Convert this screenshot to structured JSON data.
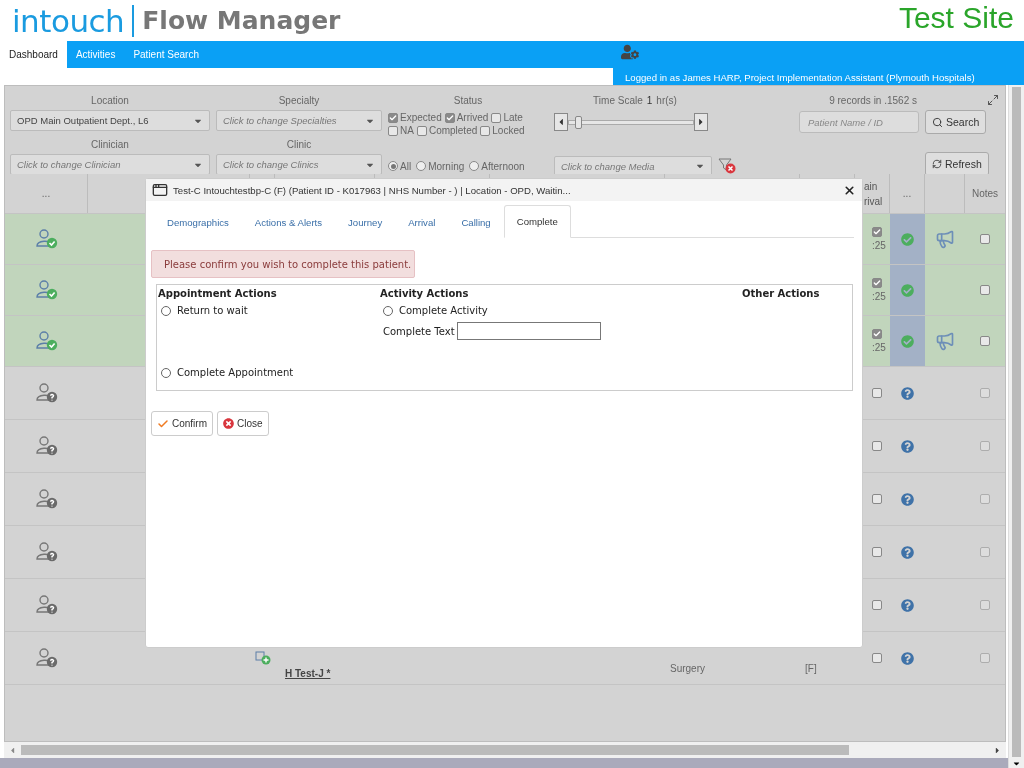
{
  "header": {
    "logo": "intouch",
    "product": "Flow Manager",
    "site": "Test Site"
  },
  "nav": {
    "tabs": [
      {
        "label": "Dashboard",
        "selected": true
      },
      {
        "label": "Activities",
        "selected": false
      },
      {
        "label": "Patient Search",
        "selected": false
      }
    ],
    "user": "Logged in as James HARP, Project Implementation Assistant (Plymouth Hospitals)"
  },
  "filters": {
    "location": {
      "label": "Location",
      "value": "OPD Main Outpatient Dept., L6"
    },
    "specialty": {
      "label": "Specialty",
      "placeholder": "Click to change Specialties"
    },
    "clinician": {
      "label": "Clinician",
      "placeholder": "Click to change Clinician"
    },
    "clinic": {
      "label": "Clinic",
      "placeholder": "Click to change Clinics"
    },
    "status": {
      "label": "Status",
      "checkboxes": [
        {
          "label": "Expected",
          "checked": true
        },
        {
          "label": "Arrived",
          "checked": true
        },
        {
          "label": "Late",
          "checked": false
        },
        {
          "label": "NA",
          "checked": false
        },
        {
          "label": "Completed",
          "checked": false
        },
        {
          "label": "Locked",
          "checked": false
        }
      ]
    },
    "session": [
      {
        "label": "All",
        "selected": true
      },
      {
        "label": "Morning",
        "selected": false
      },
      {
        "label": "Afternoon",
        "selected": false
      }
    ],
    "time_scale": {
      "label": "Time Scale",
      "value": "1",
      "unit": "hr(s)",
      "level": 0.05
    },
    "media": {
      "placeholder": "Click to change Media"
    },
    "records": "9 records in .1562 s",
    "patient_search": {
      "placeholder": "Patient Name / ID"
    },
    "search_button": "Search",
    "refresh_button": "Refresh"
  },
  "table": {
    "columns": {
      "column_1": "...",
      "column_2": "ain rival",
      "column_3": "...",
      "column_4": "Notes"
    },
    "rows": [
      {
        "kind": "arrived",
        "arrived_checked": true,
        "time": ":25",
        "announce": true,
        "notes_checked": false,
        "notes_disabled": false
      },
      {
        "kind": "arrived",
        "arrived_checked": true,
        "time": ":25",
        "announce": false,
        "notes_checked": false,
        "notes_disabled": false
      },
      {
        "kind": "arrived",
        "arrived_checked": true,
        "time": ":25",
        "announce": true,
        "notes_checked": false,
        "notes_disabled": false
      },
      {
        "kind": "expected",
        "arrived_checked": false,
        "notes_checked": false,
        "notes_disabled": true
      },
      {
        "kind": "expected",
        "arrived_checked": false,
        "notes_checked": false,
        "notes_disabled": true
      },
      {
        "kind": "expected",
        "arrived_checked": false,
        "notes_checked": false,
        "notes_disabled": true
      },
      {
        "kind": "expected",
        "arrived_checked": false,
        "notes_checked": false,
        "notes_disabled": true
      },
      {
        "kind": "expected",
        "arrived_checked": false,
        "notes_checked": false,
        "notes_disabled": true
      },
      {
        "kind": "expected",
        "arrived_checked": false,
        "new_activity": true,
        "name": "H Test-J *",
        "specialty": "Surgery",
        "gender": "[F]",
        "notes_checked": false,
        "notes_disabled": true
      }
    ]
  },
  "dialog": {
    "title": "Test-C Intouchtestbp-C (F) (Patient ID - K017963 | NHS Number - ) | Location - OPD, Waitin...",
    "tabs": [
      {
        "label": "Demographics",
        "selected": false
      },
      {
        "label": "Actions & Alerts",
        "selected": false
      },
      {
        "label": "Journey",
        "selected": false
      },
      {
        "label": "Arrival",
        "selected": false
      },
      {
        "label": "Calling",
        "selected": false
      },
      {
        "label": "Complete",
        "selected": true
      }
    ],
    "alert": "Please confirm you wish to complete this patient.",
    "appointment_actions": {
      "heading": "Appointment Actions",
      "options": [
        {
          "label": "Return to wait",
          "selected": false
        },
        {
          "label": "Complete Appointment",
          "selected": false
        }
      ]
    },
    "activity_actions": {
      "heading": "Activity Actions",
      "options": [
        {
          "label": "Complete Activity",
          "selected": false
        }
      ],
      "complete_text": {
        "label": "Complete Text"
      }
    },
    "other_actions": {
      "heading": "Other Actions"
    },
    "buttons": [
      {
        "kind": "confirm",
        "label": "Confirm"
      },
      {
        "kind": "close",
        "label": "Close"
      }
    ]
  }
}
